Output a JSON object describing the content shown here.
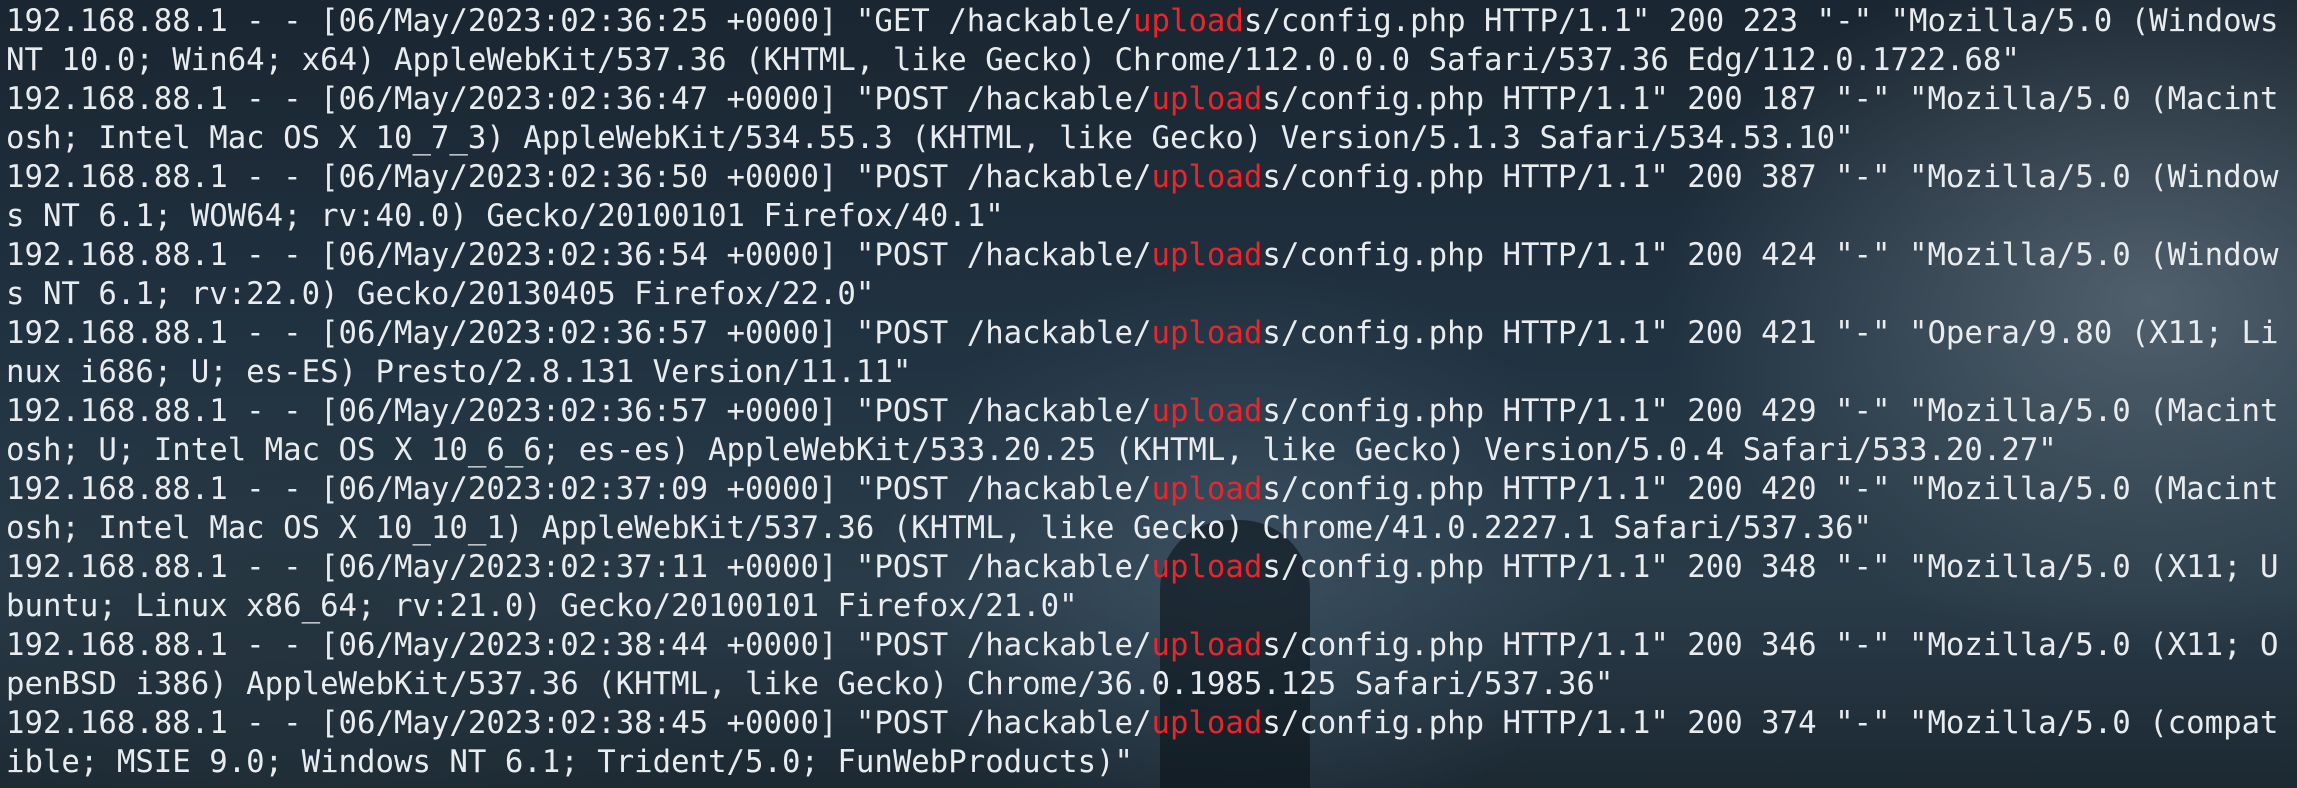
{
  "terminal": {
    "highlight_term": "upload",
    "highlight_color": "#e8262b",
    "text_color": "#e8ecef",
    "lines": [
      {
        "pre": "192.168.88.1 - - [06/May/2023:02:36:25 +0000] \"GET /hackable/",
        "hl": "upload",
        "post": "s/config.php HTTP/1.1\" 200 223 \"-\" \"Mozilla/5.0 (Windows NT 10.0; Win64; x64) AppleWebKit/537.36 (KHTML, like Gecko) Chrome/112.0.0.0 Safari/537.36 Edg/112.0.1722.68\""
      },
      {
        "pre": "192.168.88.1 - - [06/May/2023:02:36:47 +0000] \"POST /hackable/",
        "hl": "upload",
        "post": "s/config.php HTTP/1.1\" 200 187 \"-\" \"Mozilla/5.0 (Macintosh; Intel Mac OS X 10_7_3) AppleWebKit/534.55.3 (KHTML, like Gecko) Version/5.1.3 Safari/534.53.10\""
      },
      {
        "pre": "192.168.88.1 - - [06/May/2023:02:36:50 +0000] \"POST /hackable/",
        "hl": "upload",
        "post": "s/config.php HTTP/1.1\" 200 387 \"-\" \"Mozilla/5.0 (Windows NT 6.1; WOW64; rv:40.0) Gecko/20100101 Firefox/40.1\""
      },
      {
        "pre": "192.168.88.1 - - [06/May/2023:02:36:54 +0000] \"POST /hackable/",
        "hl": "upload",
        "post": "s/config.php HTTP/1.1\" 200 424 \"-\" \"Mozilla/5.0 (Windows NT 6.1; rv:22.0) Gecko/20130405 Firefox/22.0\""
      },
      {
        "pre": "192.168.88.1 - - [06/May/2023:02:36:57 +0000] \"POST /hackable/",
        "hl": "upload",
        "post": "s/config.php HTTP/1.1\" 200 421 \"-\" \"Opera/9.80 (X11; Linux i686; U; es-ES) Presto/2.8.131 Version/11.11\""
      },
      {
        "pre": "192.168.88.1 - - [06/May/2023:02:36:57 +0000] \"POST /hackable/",
        "hl": "upload",
        "post": "s/config.php HTTP/1.1\" 200 429 \"-\" \"Mozilla/5.0 (Macintosh; U; Intel Mac OS X 10_6_6; es-es) AppleWebKit/533.20.25 (KHTML, like Gecko) Version/5.0.4 Safari/533.20.27\""
      },
      {
        "pre": "192.168.88.1 - - [06/May/2023:02:37:09 +0000] \"POST /hackable/",
        "hl": "upload",
        "post": "s/config.php HTTP/1.1\" 200 420 \"-\" \"Mozilla/5.0 (Macintosh; Intel Mac OS X 10_10_1) AppleWebKit/537.36 (KHTML, like Gecko) Chrome/41.0.2227.1 Safari/537.36\""
      },
      {
        "pre": "192.168.88.1 - - [06/May/2023:02:37:11 +0000] \"POST /hackable/",
        "hl": "upload",
        "post": "s/config.php HTTP/1.1\" 200 348 \"-\" \"Mozilla/5.0 (X11; Ubuntu; Linux x86_64; rv:21.0) Gecko/20100101 Firefox/21.0\""
      },
      {
        "pre": "192.168.88.1 - - [06/May/2023:02:38:44 +0000] \"POST /hackable/",
        "hl": "upload",
        "post": "s/config.php HTTP/1.1\" 200 346 \"-\" \"Mozilla/5.0 (X11; OpenBSD i386) AppleWebKit/537.36 (KHTML, like Gecko) Chrome/36.0.1985.125 Safari/537.36\""
      },
      {
        "pre": "192.168.88.1 - - [06/May/2023:02:38:45 +0000] \"POST /hackable/",
        "hl": "upload",
        "post": "s/config.php HTTP/1.1\" 200 374 \"-\" \"Mozilla/5.0 (compatible; MSIE 9.0; Windows NT 6.1; Trident/5.0; FunWebProducts)\""
      }
    ]
  }
}
